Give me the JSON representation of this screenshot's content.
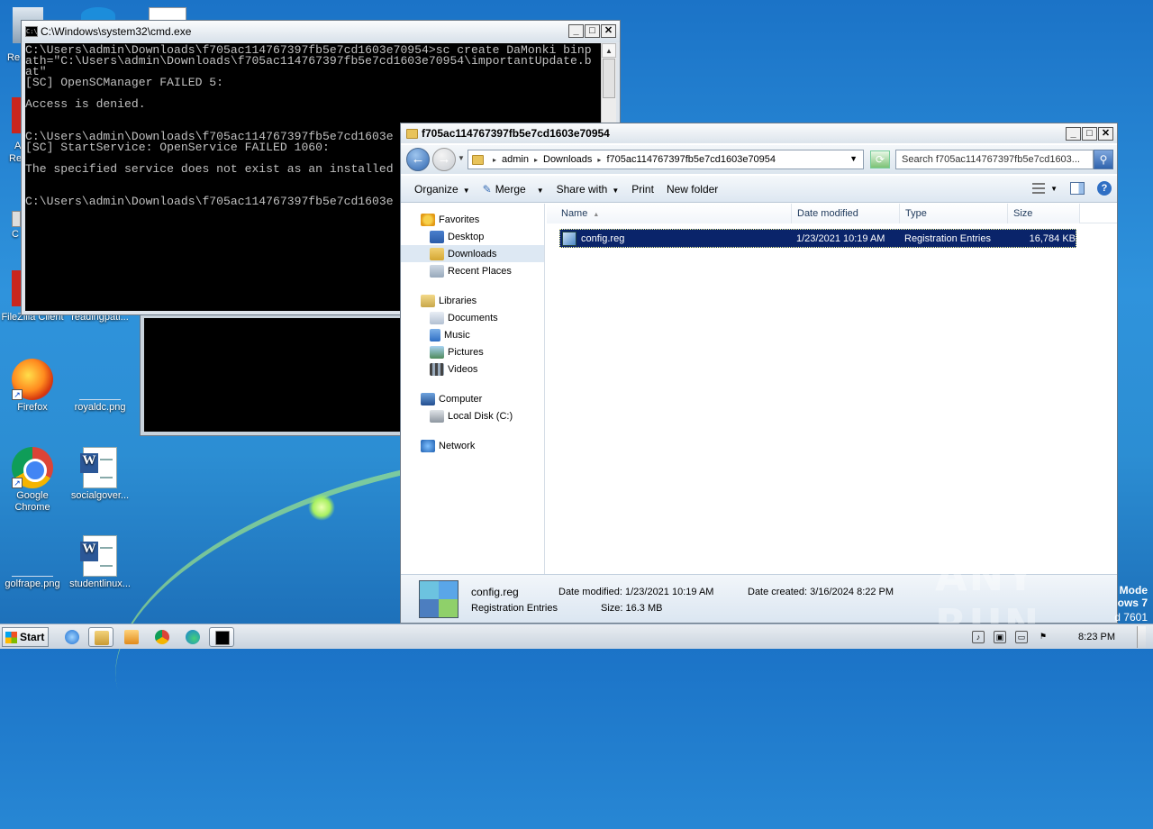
{
  "desktop": {
    "icons": [
      {
        "label": "FileZilla Client",
        "icon": "filezilla-icon"
      },
      {
        "label": "readingpati...",
        "icon": "word-document-icon"
      },
      {
        "label": "Firefox",
        "icon": "firefox-icon"
      },
      {
        "label": "royaldc.png",
        "icon": "image-file-icon"
      },
      {
        "label": "Google Chrome",
        "icon": "chrome-icon"
      },
      {
        "label": "socialgover...",
        "icon": "word-document-icon"
      },
      {
        "label": "golfrape.png",
        "icon": "image-file-icon"
      },
      {
        "label": "studentlinux...",
        "icon": "word-document-icon"
      }
    ],
    "edge_fragments": [
      "Re",
      "A",
      "Re",
      "C"
    ],
    "watermark": "ANY RUN",
    "edition_lines": [
      "Mode",
      "ows 7",
      "d 7601"
    ]
  },
  "cmd": {
    "title": "C:\\Windows\\system32\\cmd.exe",
    "lines": [
      "C:\\Users\\admin\\Downloads\\f705ac114767397fb5e7cd1603e70954>sc create DaMonki binp",
      "ath=\"C:\\Users\\admin\\Downloads\\f705ac114767397fb5e7cd1603e70954\\importantUpdate.b",
      "at\"",
      "[SC] OpenSCManager FAILED 5:",
      "",
      "Access is denied.",
      "",
      "",
      "C:\\Users\\admin\\Downloads\\f705ac114767397fb5e7cd1603e",
      "[SC] StartService: OpenService FAILED 1060:",
      "",
      "The specified service does not exist as an installed",
      "",
      "",
      "C:\\Users\\admin\\Downloads\\f705ac114767397fb5e7cd1603e"
    ]
  },
  "explorer": {
    "title": "f705ac114767397fb5e7cd1603e70954",
    "breadcrumb": [
      "admin",
      "Downloads",
      "f705ac114767397fb5e7cd1603e70954"
    ],
    "search_placeholder": "Search f705ac114767397fb5e7cd1603...",
    "toolbar": {
      "organize": "Organize",
      "merge": "Merge",
      "share_with": "Share with",
      "print": "Print",
      "new_folder": "New folder"
    },
    "nav": {
      "favorites": "Favorites",
      "desktop": "Desktop",
      "downloads": "Downloads",
      "recent_places": "Recent Places",
      "libraries": "Libraries",
      "documents": "Documents",
      "music": "Music",
      "pictures": "Pictures",
      "videos": "Videos",
      "computer": "Computer",
      "local_disk": "Local Disk (C:)",
      "network": "Network"
    },
    "columns": {
      "name": "Name",
      "date": "Date modified",
      "type": "Type",
      "size": "Size"
    },
    "files": [
      {
        "name": "config.reg",
        "date": "1/23/2021 10:19 AM",
        "type": "Registration Entries",
        "size": "16,784 KB"
      }
    ],
    "details": {
      "name": "config.reg",
      "type": "Registration Entries",
      "modified": "Date modified: 1/23/2021 10:19 AM",
      "size": "Size: 16.3 MB",
      "created": "Date created: 3/16/2024 8:22 PM"
    }
  },
  "taskbar": {
    "start": "Start",
    "clock": "8:23 PM",
    "apps": [
      "internet-explorer-icon",
      "explorer-icon",
      "media-player-icon",
      "chrome-icon",
      "edge-icon",
      "cmd-icon"
    ]
  }
}
